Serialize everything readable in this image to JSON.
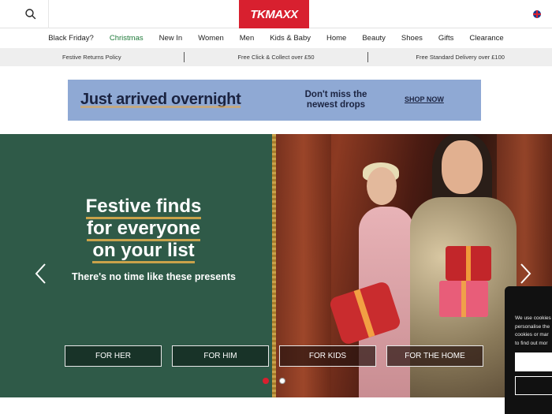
{
  "header": {
    "logo_text": "TKMAXX",
    "search_icon": "search-icon",
    "region_icon": "uk-flag-icon"
  },
  "nav": {
    "items": [
      {
        "label": "Black Friday?"
      },
      {
        "label": "Christmas"
      },
      {
        "label": "New In"
      },
      {
        "label": "Women"
      },
      {
        "label": "Men"
      },
      {
        "label": "Kids & Baby"
      },
      {
        "label": "Home"
      },
      {
        "label": "Beauty"
      },
      {
        "label": "Shoes"
      },
      {
        "label": "Gifts"
      },
      {
        "label": "Clearance"
      }
    ],
    "highlight_color": "#1f7a3a"
  },
  "infobar": {
    "items": [
      "Festive Returns Policy",
      "Free Click & Collect over £50",
      "Free Standard Delivery over £100"
    ]
  },
  "promo": {
    "title": "Just arrived overnight",
    "subtitle_line1": "Don't miss the",
    "subtitle_line2": "newest drops",
    "cta": "SHOP NOW",
    "background": "#8fa9d4"
  },
  "hero": {
    "headline_lines": [
      "Festive finds",
      "for everyone",
      "on your list"
    ],
    "subtitle": "There's no time like these presents",
    "buttons": [
      "FOR HER",
      "FOR HIM",
      "FOR KIDS",
      "FOR THE HOME"
    ],
    "prev_icon": "chevron-left-icon",
    "next_icon": "chevron-right-icon",
    "slide_count": 2,
    "active_slide": 1,
    "panel_color": "#2f5a48"
  },
  "cookie": {
    "lines": [
      "We use cookies",
      "personalise the",
      "cookies or mar",
      "to find out mor"
    ]
  },
  "colors": {
    "brand_red": "#d8202f",
    "accent_gold": "#c9a24a"
  }
}
